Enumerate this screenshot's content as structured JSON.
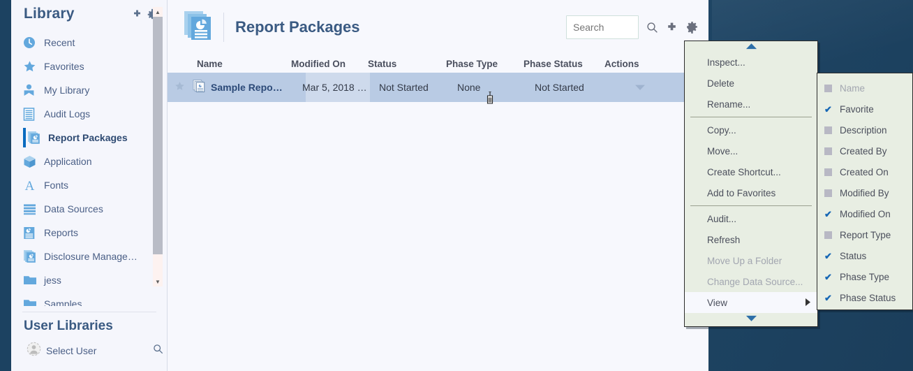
{
  "theme": {
    "background": "#1e4463",
    "sidebar_bg": "#f5f6fc",
    "main_bg": "#f7f8fd",
    "accent_blue": "#0a6bbf",
    "menu_bg": "#e8eee3",
    "row_selected": "#b9cbe4",
    "title_color": "#3a5a82"
  },
  "sidebar": {
    "title": "Library",
    "add_icon": "plus-icon",
    "settings_icon": "gear-icon",
    "items": [
      {
        "label": "Recent",
        "icon": "clock-icon",
        "selected": false
      },
      {
        "label": "Favorites",
        "icon": "star-icon",
        "selected": false
      },
      {
        "label": "My Library",
        "icon": "person-icon",
        "selected": false
      },
      {
        "label": "Audit Logs",
        "icon": "document-icon",
        "selected": false
      },
      {
        "label": "Report Packages",
        "icon": "report-stack-icon",
        "selected": true
      },
      {
        "label": "Application",
        "icon": "cube-icon",
        "selected": false
      },
      {
        "label": "Fonts",
        "icon": "font-a-icon",
        "selected": false
      },
      {
        "label": "Data Sources",
        "icon": "database-icon",
        "selected": false
      },
      {
        "label": "Reports",
        "icon": "report-icon",
        "selected": false
      },
      {
        "label": "Disclosure Manage…",
        "icon": "report-stack-icon",
        "selected": false
      },
      {
        "label": "jess",
        "icon": "folder-icon",
        "selected": false
      },
      {
        "label": "Samples",
        "icon": "folder-icon",
        "selected": false
      }
    ],
    "user_libraries_title": "User Libraries",
    "select_user_label": "Select User",
    "select_user_avatar_icon": "avatar-icon",
    "user_search_icon": "search-icon",
    "scroll_up_icon": "triangle-up-icon",
    "scroll_down_icon": "triangle-down-icon"
  },
  "main": {
    "header_icon": "report-packages-icon",
    "title": "Report Packages",
    "search": {
      "value": "",
      "placeholder": "Search"
    },
    "toolbar": [
      {
        "icon": "search-icon",
        "name": "search-button"
      },
      {
        "icon": "plus-icon",
        "name": "create-button"
      },
      {
        "icon": "gear-icon",
        "name": "actions-gear-button"
      }
    ],
    "table": {
      "columns": [
        "Name",
        "Modified On",
        "Status",
        "Phase Type",
        "Phase Status",
        "Actions"
      ],
      "rows": [
        {
          "favorite_icon": "star-outline-icon",
          "type_icon": "report-stack-icon",
          "name": "Sample Repo…",
          "modified_on": "Mar 5, 2018 …",
          "status": "Not Started",
          "phase_type": "None",
          "phase_status": "Not Started",
          "actions_icon": "caret-down-icon"
        }
      ]
    }
  },
  "context_menu": {
    "scroll_up_icon": "triangle-up-icon",
    "scroll_down_icon": "triangle-down-icon",
    "items": [
      {
        "label": "Inspect...",
        "enabled": true,
        "highlighted": false,
        "submenu": false
      },
      {
        "label": "Delete",
        "enabled": true,
        "highlighted": false,
        "submenu": false
      },
      {
        "label": "Rename...",
        "enabled": true,
        "highlighted": false,
        "submenu": false
      },
      {
        "separator": true
      },
      {
        "label": "Copy...",
        "enabled": true,
        "highlighted": false,
        "submenu": false
      },
      {
        "label": "Move...",
        "enabled": true,
        "highlighted": false,
        "submenu": false
      },
      {
        "label": "Create Shortcut...",
        "enabled": true,
        "highlighted": false,
        "submenu": false
      },
      {
        "label": "Add to Favorites",
        "enabled": true,
        "highlighted": false,
        "submenu": false
      },
      {
        "separator": true
      },
      {
        "label": "Audit...",
        "enabled": true,
        "highlighted": false,
        "submenu": false
      },
      {
        "label": "Refresh",
        "enabled": true,
        "highlighted": false,
        "submenu": false
      },
      {
        "label": "Move Up a Folder",
        "enabled": false,
        "highlighted": false,
        "submenu": false
      },
      {
        "label": "Change Data Source...",
        "enabled": false,
        "highlighted": false,
        "submenu": false
      },
      {
        "label": "View",
        "enabled": true,
        "highlighted": true,
        "submenu": true,
        "arrow_icon": "caret-right-icon"
      }
    ]
  },
  "view_submenu": {
    "items": [
      {
        "label": "Name",
        "checked": false,
        "enabled": false
      },
      {
        "label": "Favorite",
        "checked": true,
        "enabled": true
      },
      {
        "label": "Description",
        "checked": false,
        "enabled": true
      },
      {
        "label": "Created By",
        "checked": false,
        "enabled": true
      },
      {
        "label": "Created On",
        "checked": false,
        "enabled": true
      },
      {
        "label": "Modified By",
        "checked": false,
        "enabled": true
      },
      {
        "label": "Modified On",
        "checked": true,
        "enabled": true
      },
      {
        "label": "Report Type",
        "checked": false,
        "enabled": true
      },
      {
        "label": "Status",
        "checked": true,
        "enabled": true
      },
      {
        "label": "Phase Type",
        "checked": true,
        "enabled": true
      },
      {
        "label": "Phase Status",
        "checked": true,
        "enabled": true
      }
    ],
    "check_glyph": "✔"
  },
  "cursor": {
    "type": "text-ibeam"
  }
}
